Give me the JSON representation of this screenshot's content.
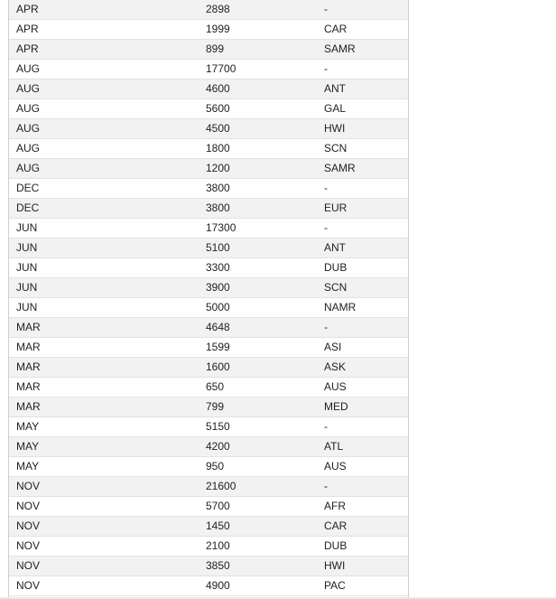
{
  "table": {
    "rows": [
      [
        "APR",
        "2898",
        "-"
      ],
      [
        "APR",
        "1999",
        "CAR"
      ],
      [
        "APR",
        "899",
        "SAMR"
      ],
      [
        "AUG",
        "17700",
        "-"
      ],
      [
        "AUG",
        "4600",
        "ANT"
      ],
      [
        "AUG",
        "5600",
        "GAL"
      ],
      [
        "AUG",
        "4500",
        "HWI"
      ],
      [
        "AUG",
        "1800",
        "SCN"
      ],
      [
        "AUG",
        "1200",
        "SAMR"
      ],
      [
        "DEC",
        "3800",
        "-"
      ],
      [
        "DEC",
        "3800",
        "EUR"
      ],
      [
        "JUN",
        "17300",
        "-"
      ],
      [
        "JUN",
        "5100",
        "ANT"
      ],
      [
        "JUN",
        "3300",
        "DUB"
      ],
      [
        "JUN",
        "3900",
        "SCN"
      ],
      [
        "JUN",
        "5000",
        "NAMR"
      ],
      [
        "MAR",
        "4648",
        "-"
      ],
      [
        "MAR",
        "1599",
        "ASI"
      ],
      [
        "MAR",
        "1600",
        "ASK"
      ],
      [
        "MAR",
        "650",
        "AUS"
      ],
      [
        "MAR",
        "799",
        "MED"
      ],
      [
        "MAY",
        "5150",
        "-"
      ],
      [
        "MAY",
        "4200",
        "ATL"
      ],
      [
        "MAY",
        "950",
        "AUS"
      ],
      [
        "NOV",
        "21600",
        "-"
      ],
      [
        "NOV",
        "5700",
        "AFR"
      ],
      [
        "NOV",
        "1450",
        "CAR"
      ],
      [
        "NOV",
        "2100",
        "DUB"
      ],
      [
        "NOV",
        "3850",
        "HWI"
      ],
      [
        "NOV",
        "4900",
        "PAC"
      ]
    ]
  }
}
